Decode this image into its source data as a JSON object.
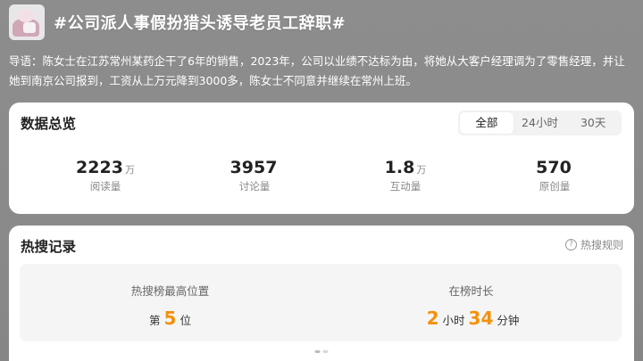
{
  "header": {
    "title": "#公司派人事假扮猎头诱导老员工辞职#"
  },
  "intro": {
    "text": "导语：陈女士在江苏常州某药企干了6年的销售，2023年，公司以业绩不达标为由，将她从大客户经理调为了零售经理，并让她到南京公司报到，工资从上万元降到3000多，陈女士不同意并继续在常州上班。"
  },
  "overview": {
    "title": "数据总览",
    "tabs": [
      "全部",
      "24小时",
      "30天"
    ],
    "active_tab": "全部",
    "stats": [
      {
        "value": "2223",
        "unit": "万",
        "label": "阅读量"
      },
      {
        "value": "3957",
        "unit": "",
        "label": "讨论量"
      },
      {
        "value": "1.8",
        "unit": "万",
        "label": "互动量"
      },
      {
        "value": "570",
        "unit": "",
        "label": "原创量"
      }
    ]
  },
  "hot": {
    "title": "热搜记录",
    "rule_label": "热搜规则",
    "rule_icon": "question-circle-icon",
    "best_position": {
      "caption": "热搜榜最高位置",
      "prefix": "第",
      "value": "5",
      "suffix": "位"
    },
    "duration": {
      "caption": "在榜时长",
      "hours": "2",
      "hours_unit": "小时",
      "minutes": "34",
      "minutes_unit": "分钟"
    }
  },
  "colors": {
    "accent": "#f5900b",
    "background": "#8a8a8a"
  }
}
